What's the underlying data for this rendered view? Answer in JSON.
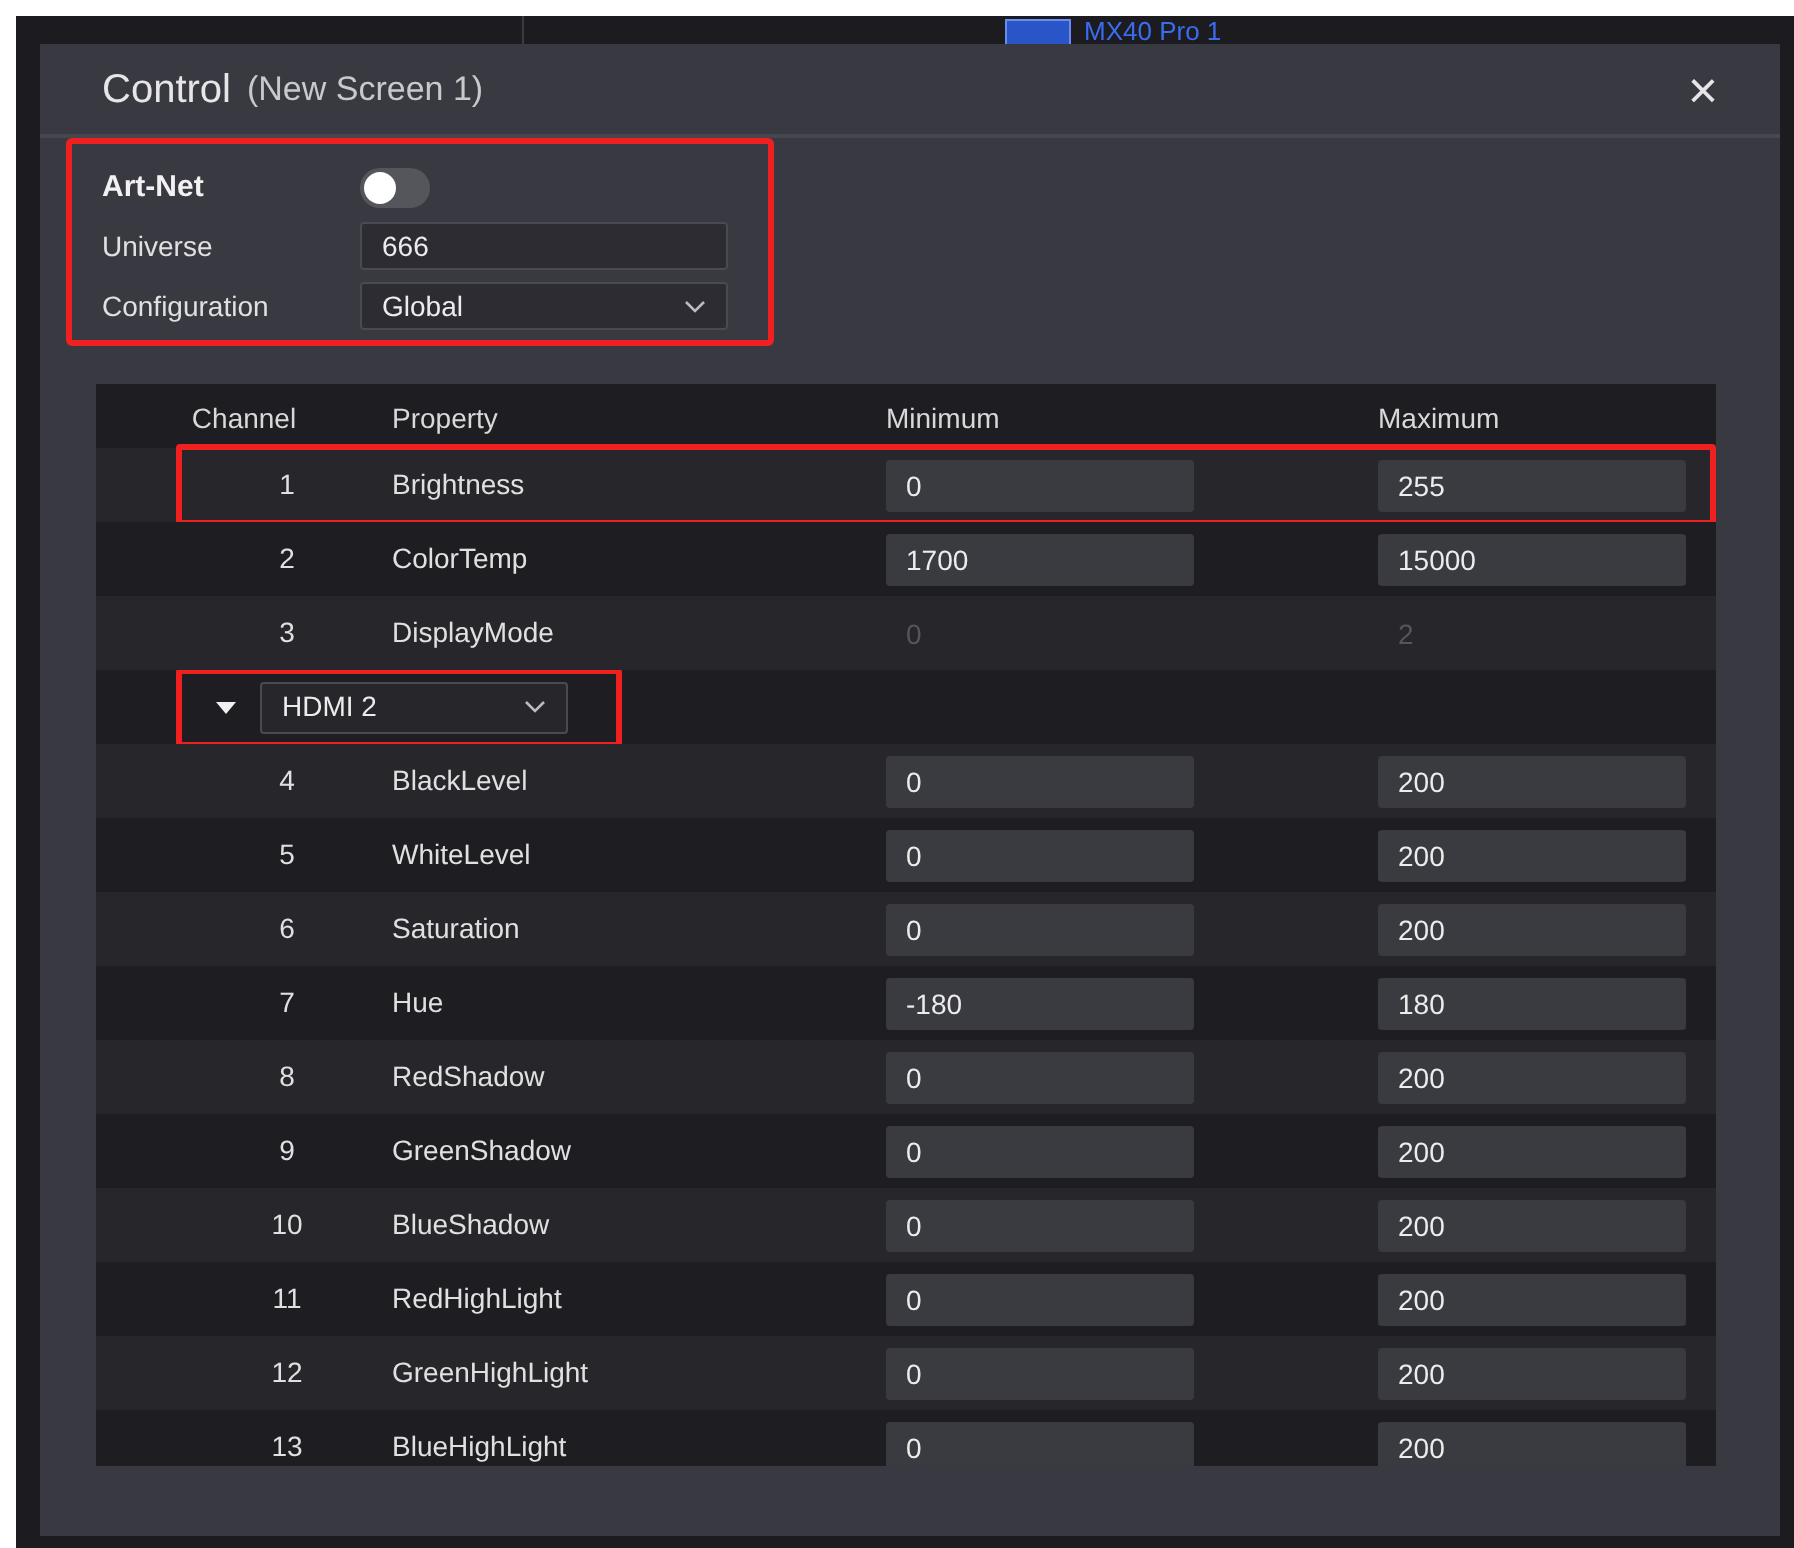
{
  "background": {
    "device_label": "MX40 Pro 1"
  },
  "dialog": {
    "title": "Control",
    "subtitle": "(New Screen 1)",
    "close": "×"
  },
  "art_net": {
    "highlighted": true,
    "label": "Art-Net",
    "on": false,
    "universe": {
      "label": "Universe",
      "value": "666"
    },
    "configuration": {
      "label": "Configuration",
      "value": "Global"
    }
  },
  "table": {
    "columns": [
      "Channel",
      "Property",
      "Minimum",
      "Maximum"
    ],
    "rows": [
      {
        "kind": "property",
        "channel": "1",
        "property": "Brightness",
        "minimum": "0",
        "maximum": "255",
        "disabled": false,
        "highlighted": true
      },
      {
        "kind": "property",
        "channel": "2",
        "property": "ColorTemp",
        "minimum": "1700",
        "maximum": "15000",
        "disabled": false,
        "highlighted": false
      },
      {
        "kind": "property",
        "channel": "3",
        "property": "DisplayMode",
        "minimum": "0",
        "maximum": "2",
        "disabled": true,
        "highlighted": false
      },
      {
        "kind": "group",
        "expanded": true,
        "source": "HDMI 2",
        "highlighted": true
      },
      {
        "kind": "property",
        "channel": "4",
        "property": "BlackLevel",
        "minimum": "0",
        "maximum": "200",
        "disabled": false,
        "highlighted": false
      },
      {
        "kind": "property",
        "channel": "5",
        "property": "WhiteLevel",
        "minimum": "0",
        "maximum": "200",
        "disabled": false,
        "highlighted": false
      },
      {
        "kind": "property",
        "channel": "6",
        "property": "Saturation",
        "minimum": "0",
        "maximum": "200",
        "disabled": false,
        "highlighted": false
      },
      {
        "kind": "property",
        "channel": "7",
        "property": "Hue",
        "minimum": "-180",
        "maximum": "180",
        "disabled": false,
        "highlighted": false
      },
      {
        "kind": "property",
        "channel": "8",
        "property": "RedShadow",
        "minimum": "0",
        "maximum": "200",
        "disabled": false,
        "highlighted": false
      },
      {
        "kind": "property",
        "channel": "9",
        "property": "GreenShadow",
        "minimum": "0",
        "maximum": "200",
        "disabled": false,
        "highlighted": false
      },
      {
        "kind": "property",
        "channel": "10",
        "property": "BlueShadow",
        "minimum": "0",
        "maximum": "200",
        "disabled": false,
        "highlighted": false
      },
      {
        "kind": "property",
        "channel": "11",
        "property": "RedHighLight",
        "minimum": "0",
        "maximum": "200",
        "disabled": false,
        "highlighted": false
      },
      {
        "kind": "property",
        "channel": "12",
        "property": "GreenHighLight",
        "minimum": "0",
        "maximum": "200",
        "disabled": false,
        "highlighted": false
      },
      {
        "kind": "property",
        "channel": "13",
        "property": "BlueHighLight",
        "minimum": "0",
        "maximum": "200",
        "disabled": false,
        "highlighted": false
      }
    ]
  }
}
